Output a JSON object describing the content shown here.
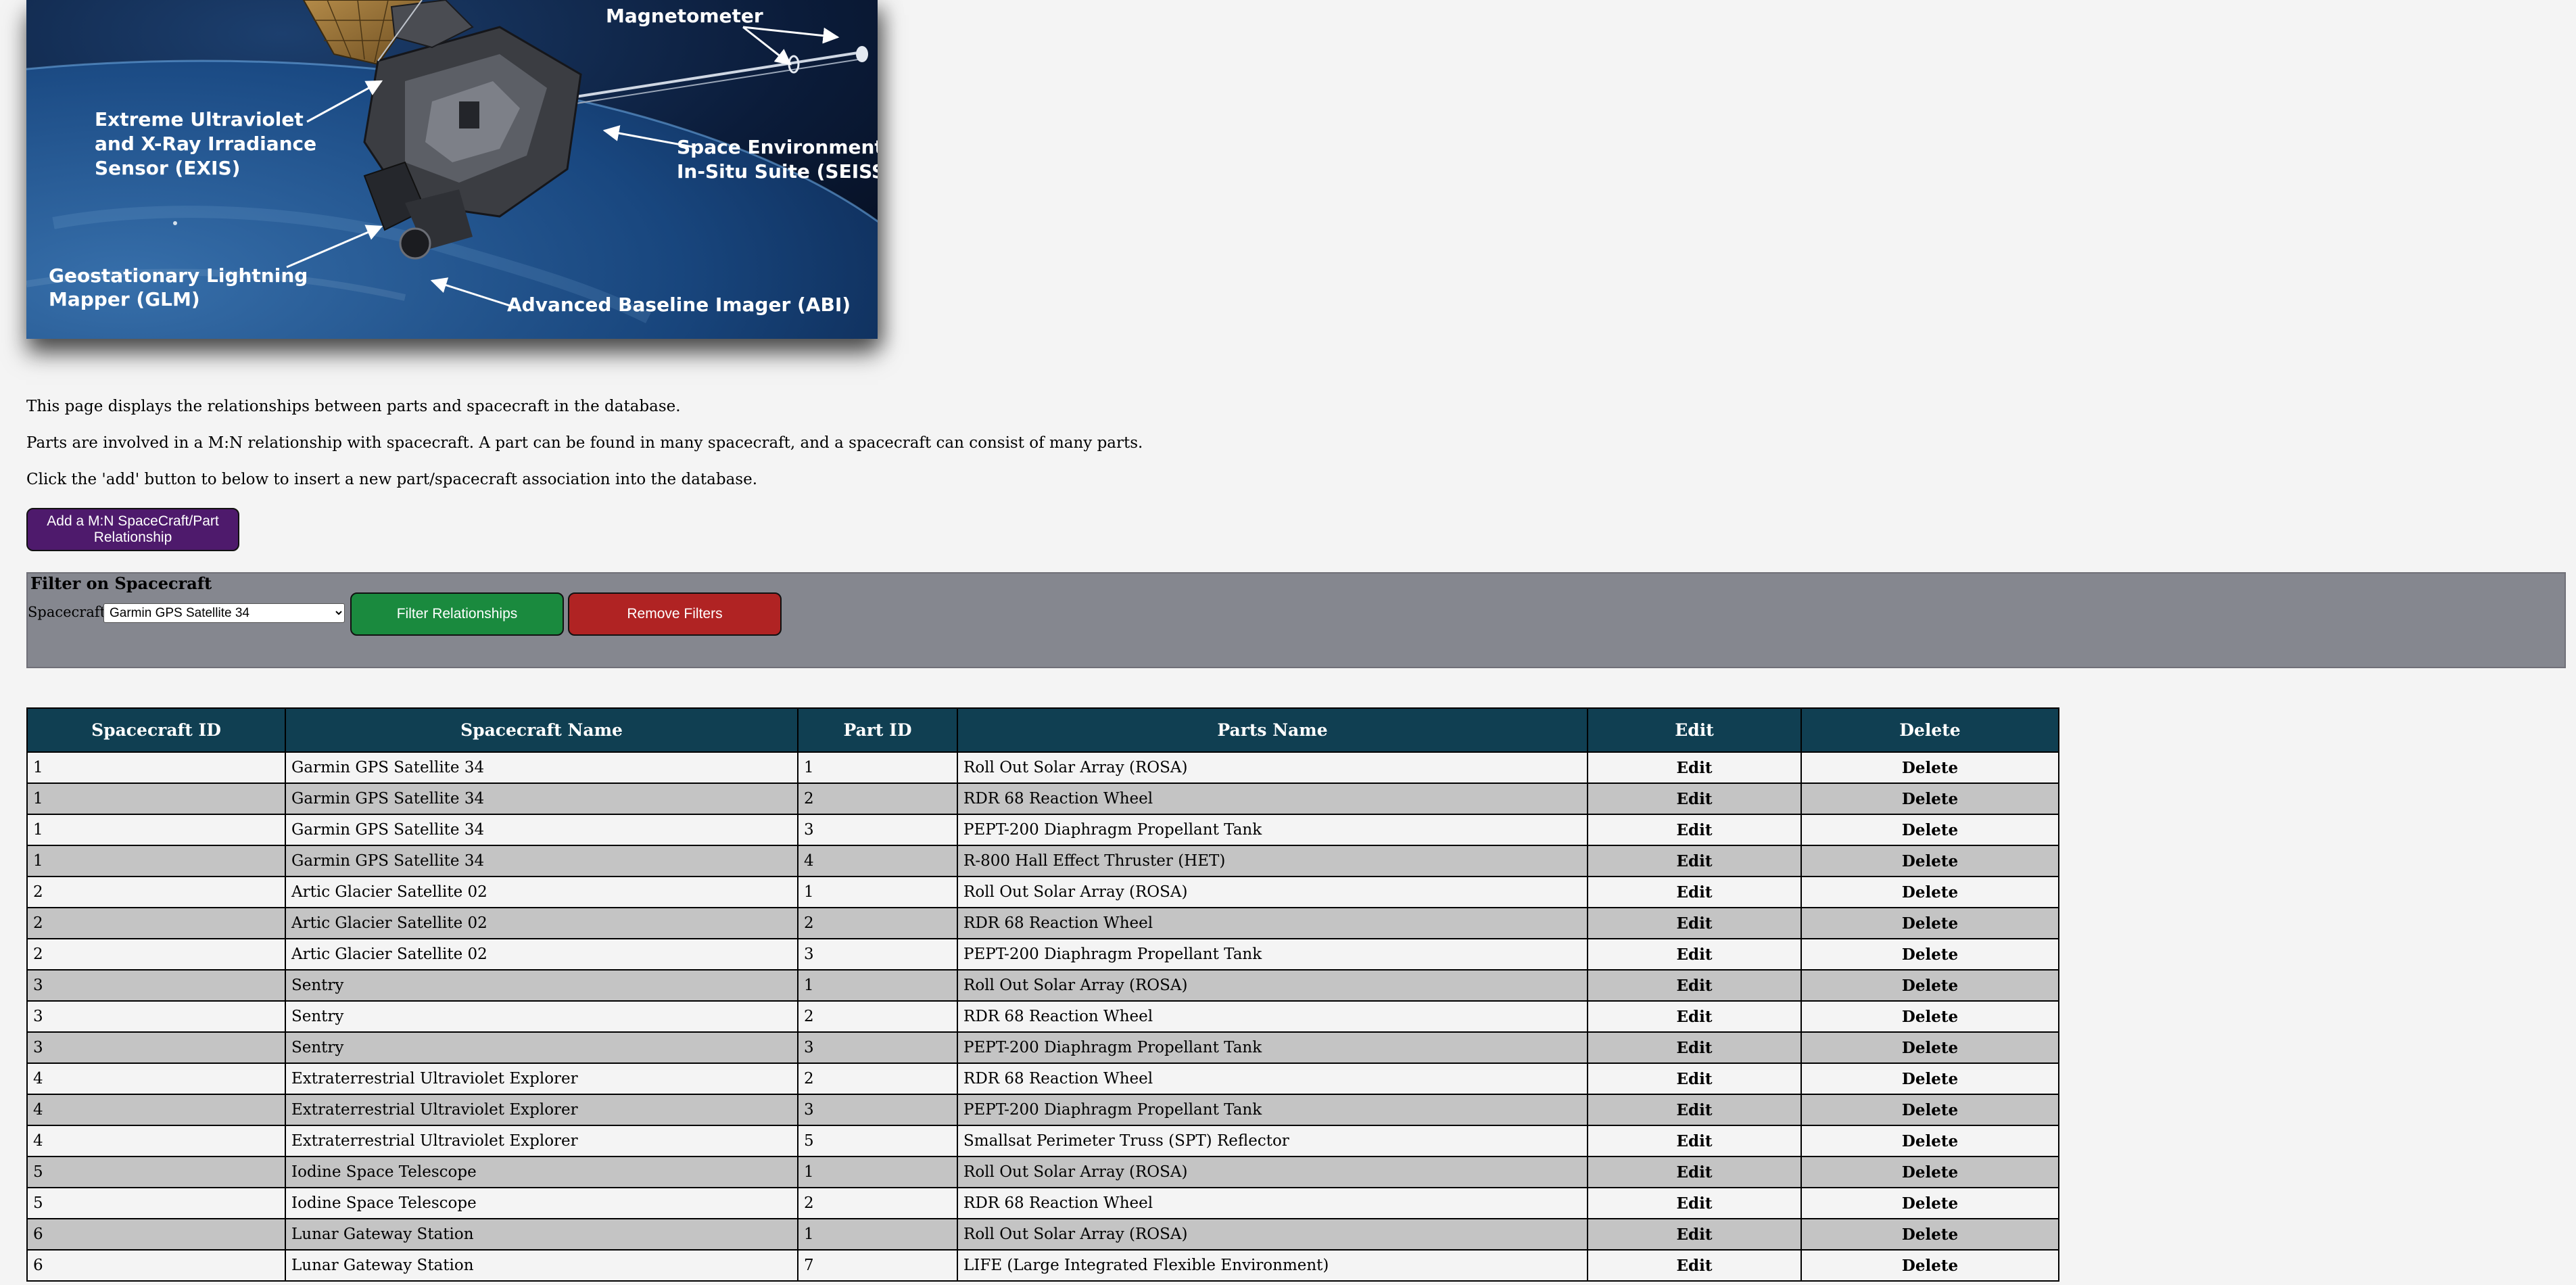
{
  "hero": {
    "labels": {
      "magnetometer": "Magnetometer",
      "exis_1": "Extreme Ultraviolet",
      "exis_2": "and X-Ray Irradiance",
      "exis_3": "Sensor (EXIS)",
      "seiss_1": "Space Environment",
      "seiss_2": "In-Situ Suite  (SEISS)",
      "glm_1": "Geostationary Lightning",
      "glm_2": "Mapper (GLM)",
      "abi": "Advanced Baseline Imager (ABI)"
    }
  },
  "intro": {
    "p1": "This page displays the relationships between parts and spacecraft in the database.",
    "p2": "Parts are involved in a M:N relationship with spacecraft. A part can be found in many spacecraft, and a spacecraft can consist of many parts.",
    "p3": "Click the 'add' button to below to insert a new part/spacecraft association into the database."
  },
  "add_button": {
    "label": "Add a M:N SpaceCraft/Part Relationship"
  },
  "filter": {
    "heading": "Filter on Spacecraft",
    "spacecraft_label": "Spacecraft",
    "selected_spacecraft": "Garmin GPS Satellite 34",
    "filter_button": "Filter Relationships",
    "remove_button": "Remove Filters"
  },
  "table": {
    "headers": [
      "Spacecraft ID",
      "Spacecraft Name",
      "Part ID",
      "Parts Name",
      "Edit",
      "Delete"
    ],
    "edit_label": "Edit",
    "delete_label": "Delete",
    "rows": [
      [
        "1",
        "Garmin GPS Satellite 34",
        "1",
        "Roll Out Solar Array (ROSA)"
      ],
      [
        "1",
        "Garmin GPS Satellite 34",
        "2",
        "RDR 68 Reaction Wheel"
      ],
      [
        "1",
        "Garmin GPS Satellite 34",
        "3",
        "PEPT-200 Diaphragm Propellant Tank"
      ],
      [
        "1",
        "Garmin GPS Satellite 34",
        "4",
        "R-800 Hall Effect Thruster (HET)"
      ],
      [
        "2",
        "Artic Glacier Satellite 02",
        "1",
        "Roll Out Solar Array (ROSA)"
      ],
      [
        "2",
        "Artic Glacier Satellite 02",
        "2",
        "RDR 68 Reaction Wheel"
      ],
      [
        "2",
        "Artic Glacier Satellite 02",
        "3",
        "PEPT-200 Diaphragm Propellant Tank"
      ],
      [
        "3",
        "Sentry",
        "1",
        "Roll Out Solar Array (ROSA)"
      ],
      [
        "3",
        "Sentry",
        "2",
        "RDR 68 Reaction Wheel"
      ],
      [
        "3",
        "Sentry",
        "3",
        "PEPT-200 Diaphragm Propellant Tank"
      ],
      [
        "4",
        "Extraterrestrial Ultraviolet Explorer",
        "2",
        "RDR 68 Reaction Wheel"
      ],
      [
        "4",
        "Extraterrestrial Ultraviolet Explorer",
        "3",
        "PEPT-200 Diaphragm Propellant Tank"
      ],
      [
        "4",
        "Extraterrestrial Ultraviolet Explorer",
        "5",
        "Smallsat Perimeter Truss (SPT) Reflector"
      ],
      [
        "5",
        "Iodine Space Telescope",
        "1",
        "Roll Out Solar Array (ROSA)"
      ],
      [
        "5",
        "Iodine Space Telescope",
        "2",
        "RDR 68 Reaction Wheel"
      ],
      [
        "6",
        "Lunar Gateway Station",
        "1",
        "Roll Out Solar Array (ROSA)"
      ],
      [
        "6",
        "Lunar Gateway Station",
        "7",
        "LIFE (Large Integrated Flexible Environment)"
      ]
    ]
  },
  "colors": {
    "add_button": "#4e1a6c",
    "filter_button": "#1a8a3e",
    "remove_button": "#b02323",
    "table_header": "#103f52",
    "filter_panel": "#85878f"
  }
}
